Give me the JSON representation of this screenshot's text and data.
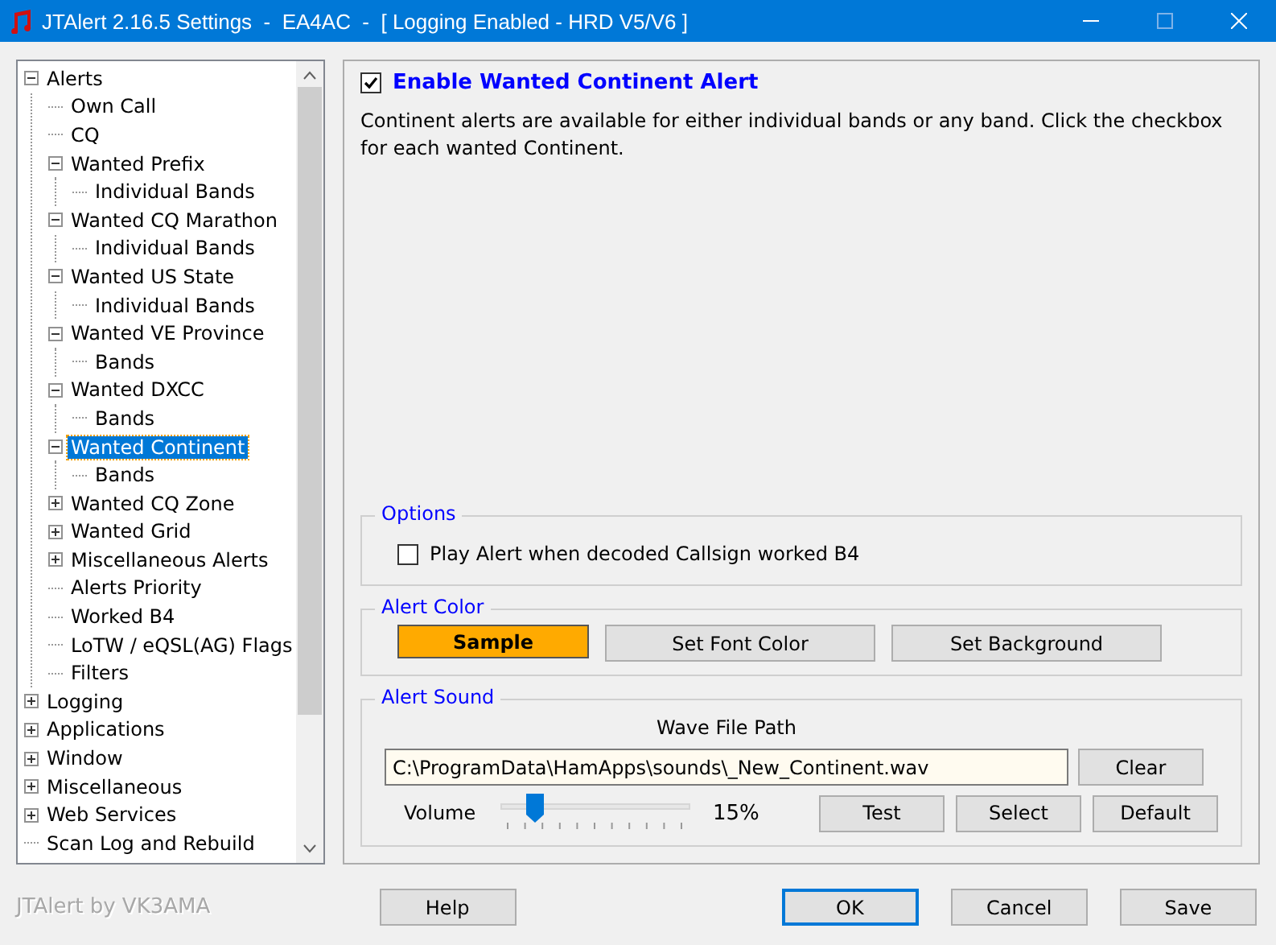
{
  "window": {
    "title": "JTAlert 2.16.5 Settings  -  EA4AC  -  [ Logging Enabled - HRD V5/V6 ]"
  },
  "tree": [
    {
      "label": "Alerts",
      "expanded": true,
      "selected": false,
      "children": [
        {
          "label": "Own Call",
          "selected": false
        },
        {
          "label": "CQ",
          "selected": false
        },
        {
          "label": "Wanted Prefix",
          "expanded": true,
          "selected": false,
          "children": [
            {
              "label": "Individual Bands",
              "selected": false
            }
          ]
        },
        {
          "label": "Wanted CQ Marathon",
          "expanded": true,
          "selected": false,
          "children": [
            {
              "label": "Individual Bands",
              "selected": false
            }
          ]
        },
        {
          "label": "Wanted US State",
          "expanded": true,
          "selected": false,
          "children": [
            {
              "label": "Individual Bands",
              "selected": false
            }
          ]
        },
        {
          "label": "Wanted VE Province",
          "expanded": true,
          "selected": false,
          "children": [
            {
              "label": "Bands",
              "selected": false
            }
          ]
        },
        {
          "label": "Wanted DXCC",
          "expanded": true,
          "selected": false,
          "children": [
            {
              "label": "Bands",
              "selected": false
            }
          ]
        },
        {
          "label": "Wanted Continent",
          "expanded": true,
          "selected": true,
          "children": [
            {
              "label": "Bands",
              "selected": false
            }
          ]
        },
        {
          "label": "Wanted CQ Zone",
          "expanded": false,
          "selected": false
        },
        {
          "label": "Wanted Grid",
          "expanded": false,
          "selected": false
        },
        {
          "label": "Miscellaneous Alerts",
          "expanded": false,
          "selected": false
        },
        {
          "label": "Alerts Priority",
          "selected": false
        },
        {
          "label": "Worked B4",
          "selected": false
        },
        {
          "label": "LoTW / eQSL(AG) Flags",
          "selected": false
        },
        {
          "label": "Filters",
          "selected": false
        }
      ]
    },
    {
      "label": "Logging",
      "expanded": false,
      "selected": false
    },
    {
      "label": "Applications",
      "expanded": false,
      "selected": false
    },
    {
      "label": "Window",
      "expanded": false,
      "selected": false
    },
    {
      "label": "Miscellaneous",
      "expanded": false,
      "selected": false
    },
    {
      "label": "Web Services",
      "expanded": false,
      "selected": false
    },
    {
      "label": "Scan Log and Rebuild",
      "selected": false
    }
  ],
  "enable": {
    "label": "Enable Wanted Continent Alert",
    "checked": true
  },
  "description": "Continent alerts are available for either individual bands or any band. Click the checkbox for each wanted Continent.",
  "options": {
    "title": "Options",
    "play_alert": {
      "label": "Play Alert when decoded Callsign worked B4",
      "checked": false
    }
  },
  "alert_color": {
    "title": "Alert Color",
    "sample": "Sample",
    "buttons": [
      "Set Font Color",
      "Set Background"
    ]
  },
  "alert_sound": {
    "title": "Alert Sound",
    "path_label": "Wave File Path",
    "path": "C:\\ProgramData\\HamApps\\sounds\\_New_Continent.wav",
    "clear": "Clear",
    "volume_label": "Volume",
    "volume": {
      "level": 0.15,
      "reading": "15%"
    },
    "buttons": [
      "Test",
      "Select",
      "Default"
    ]
  },
  "footer": {
    "credit": "JTAlert by VK3AMA",
    "buttons": [
      {
        "label": "Help",
        "default": false
      },
      {
        "label": "OK",
        "default": true
      },
      {
        "label": "Cancel",
        "default": false
      },
      {
        "label": "Save",
        "default": false
      }
    ]
  }
}
